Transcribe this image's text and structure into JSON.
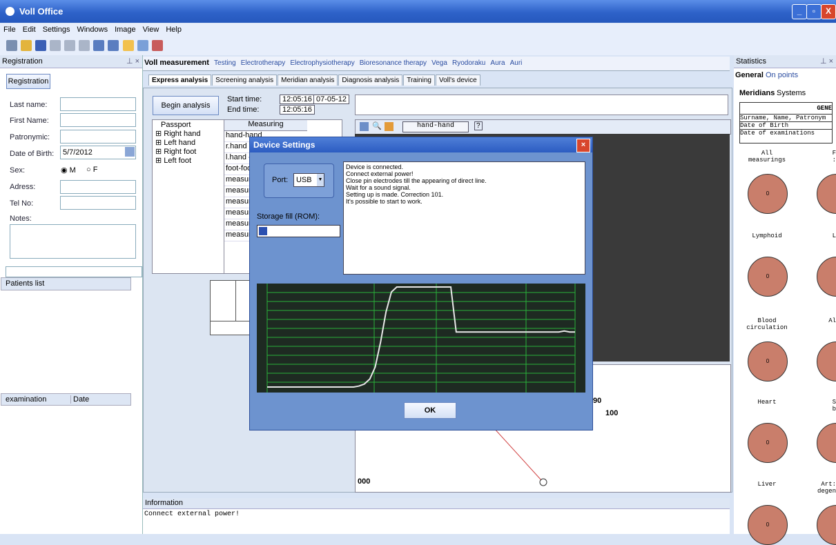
{
  "app": {
    "title": "Voll Office"
  },
  "menu": [
    "File",
    "Edit",
    "Settings",
    "Windows",
    "Image",
    "View",
    "Help"
  ],
  "registration": {
    "panel_title": "Registration",
    "button": "Registration",
    "labels": {
      "last_name": "Last name:",
      "first_name": "First Name:",
      "patronymic": "Patronymic:",
      "dob": "Date of Birth:",
      "sex": "Sex:",
      "address": "Adress:",
      "tel": "Tel No:",
      "notes": "Notes:"
    },
    "dob_value": "5/7/2012",
    "sex_m": "M",
    "sex_f": "F",
    "patients_list": "Patients list",
    "exam_col": "examination",
    "date_col": "Date"
  },
  "main_tabs": [
    "Voll measurement",
    "Testing",
    "Electrotherapy",
    "Electrophysiotherapy",
    "Bioresonance therapy",
    "Vega",
    "Ryodoraku",
    "Aura",
    "Auri"
  ],
  "sub_tabs": [
    "Express analysis",
    "Screening analysis",
    "Meridian analysis",
    "Diagnosis analysis",
    "Training",
    "Voll's device"
  ],
  "analysis": {
    "begin_button": "Begin analysis",
    "start_label": "Start time:",
    "end_label": "End time:",
    "start_time": "12:05:16",
    "end_time": "12:05:16",
    "date": "07-05-12",
    "tree": [
      "Passport",
      "Right hand",
      "Left hand",
      "Right foot",
      "Left foot"
    ],
    "measuring_header": "Measuring",
    "measuring_rows": [
      "hand-hand",
      "r.hand - r",
      "l.hand - l.",
      "foot-foot",
      "measuring",
      "measuring",
      "measuring",
      "measuring",
      "measuring",
      "measuring"
    ],
    "combo": "hand-hand",
    "gauge_90": "90",
    "gauge_100": "100",
    "gauge_000": "000"
  },
  "dialog": {
    "title": "Device Settings",
    "port_label": "Port:",
    "port_value": "USB",
    "storage_label": "Storage fill (ROM):",
    "storage_fill": 0.1,
    "messages": [
      "Device is connected.",
      "Connect external power!",
      "Close pin electrodes till the appearing of direct line.",
      "Wait for a sound signal.",
      "Setting up is made. Correction 101.",
      "It's possible to start to work."
    ],
    "ok": "OK",
    "signal": [
      0,
      0,
      0,
      0,
      0,
      0,
      0,
      0,
      0,
      0,
      0,
      0,
      0,
      0,
      0,
      0,
      0,
      1,
      3,
      8,
      20,
      45,
      75,
      95,
      100,
      100,
      100,
      100,
      100,
      100,
      100,
      100,
      100,
      100,
      100,
      55,
      55,
      55,
      55,
      55,
      55,
      55,
      55,
      55,
      55,
      55,
      55,
      55,
      55,
      55,
      55,
      55,
      55,
      55,
      55,
      56,
      55,
      55
    ]
  },
  "information": {
    "title": "Information",
    "text": "Connect external power!"
  },
  "statistics": {
    "panel_title": "Statistics",
    "tabs": [
      "General",
      "On points"
    ],
    "subtabs": [
      "Meridians",
      "Systems"
    ],
    "table_header": "GENE",
    "table_rows": [
      "Surname, Name, Patronym",
      "Date of Birth",
      "Date of examinations"
    ],
    "left_col": [
      "All\nmeasurings",
      "Lymphoid",
      "Blood\ncirculation",
      "Heart",
      "Liver"
    ],
    "right_col": [
      "F\n:",
      "L",
      "Al",
      "S\nb",
      "Art:\ndegen"
    ],
    "circle_value": "0"
  },
  "colors": {
    "accent": "#2e62c9",
    "circle": "#c97e6b",
    "graph_bg": "#1e2a22",
    "graph_grid": "#29b23a"
  }
}
